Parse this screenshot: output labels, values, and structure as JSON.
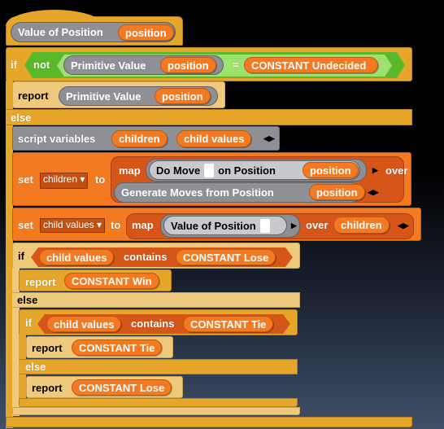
{
  "hat": {
    "name": "Value of Position",
    "param": "position"
  },
  "if1": {
    "if": "if",
    "not": "not",
    "reporter": "Primitive Value",
    "arg": "position",
    "eq": "=",
    "constant": "CONSTANT Undecided"
  },
  "report1": {
    "label": "report",
    "reporter": "Primitive Value",
    "arg": "position"
  },
  "else1": "else",
  "scriptvars": {
    "label": "script variables",
    "vars": [
      "children",
      "child values"
    ]
  },
  "set1": {
    "set": "set",
    "var": "children",
    "to": "to",
    "map": "map",
    "fn1": "Do Move",
    "fn2": "on Position",
    "arg": "position",
    "over": "over",
    "list": "Generate Moves from Position",
    "list_arg": "position"
  },
  "set2": {
    "set": "set",
    "var": "child values",
    "to": "to",
    "map": "map",
    "fn": "Value of Position",
    "over": "over",
    "list": "children"
  },
  "if2": {
    "if": "if",
    "list": "child values",
    "contains": "contains",
    "item": "CONSTANT Lose"
  },
  "report2": {
    "label": "report",
    "value": "CONSTANT Win"
  },
  "else2": "else",
  "if3": {
    "if": "if",
    "list": "child values",
    "contains": "contains",
    "item": "CONSTANT Tie"
  },
  "report3": {
    "label": "report",
    "value": "CONSTANT Tie"
  },
  "else3": "else",
  "report4": {
    "label": "report",
    "value": "CONSTANT Lose"
  },
  "colors": {
    "control": "#e6a62a",
    "control_zebra": "#f0ca7c",
    "variables": "#f47a22",
    "lists": "#d6561a",
    "operators": "#59b929",
    "other": "#8e9095"
  }
}
